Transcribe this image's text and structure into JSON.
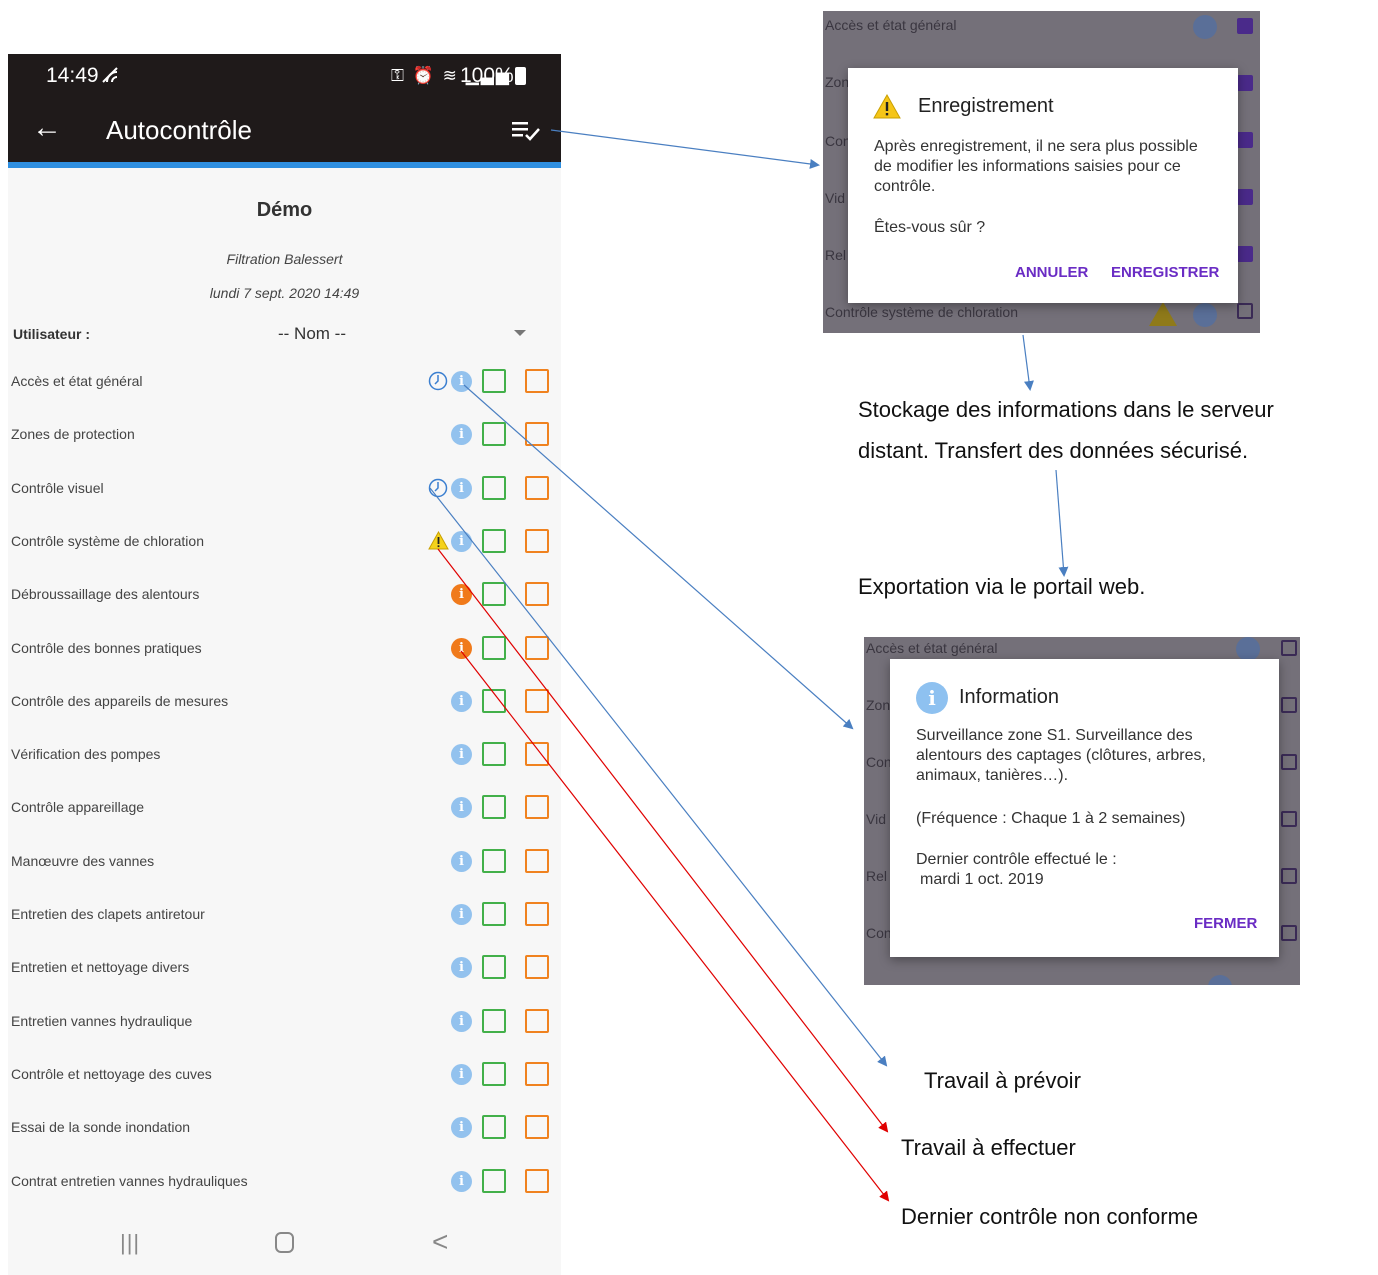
{
  "status_bar": {
    "time": "14:49",
    "signal_icon": "wifi-call-icon",
    "icons": "key alarm wifi-call signal",
    "battery": "100%"
  },
  "app_bar": {
    "title": "Autocontrôle",
    "back_icon": "arrow-left-icon",
    "action_icon": "list-check-icon"
  },
  "header": {
    "name": "Démo",
    "site": "Filtration Balessert",
    "datetime": "lundi 7 sept. 2020 14:49"
  },
  "user": {
    "label": "Utilisateur :",
    "value": "-- Nom --"
  },
  "rows": [
    {
      "label": "Accès et état général",
      "marker": "clock",
      "info": "blue"
    },
    {
      "label": "Zones de protection",
      "marker": "",
      "info": "blue"
    },
    {
      "label": "Contrôle visuel",
      "marker": "clock",
      "info": "blue"
    },
    {
      "label": "Contrôle système de chloration",
      "marker": "warning",
      "info": "blue"
    },
    {
      "label": "Débroussaillage des alentours",
      "marker": "",
      "info": "orange"
    },
    {
      "label": "Contrôle des bonnes pratiques",
      "marker": "",
      "info": "orange"
    },
    {
      "label": "Contrôle des appareils de mesures",
      "marker": "",
      "info": "blue"
    },
    {
      "label": "Vérification des pompes",
      "marker": "",
      "info": "blue"
    },
    {
      "label": "Contrôle appareillage",
      "marker": "",
      "info": "blue"
    },
    {
      "label": "Manœuvre des vannes",
      "marker": "",
      "info": "blue"
    },
    {
      "label": "Entretien des clapets antiretour",
      "marker": "",
      "info": "blue"
    },
    {
      "label": "Entretien et nettoyage divers",
      "marker": "",
      "info": "blue"
    },
    {
      "label": "Entretien vannes hydraulique",
      "marker": "",
      "info": "blue"
    },
    {
      "label": "Contrôle et nettoyage des cuves",
      "marker": "",
      "info": "blue"
    },
    {
      "label": "Essai de la sonde inondation",
      "marker": "",
      "info": "blue"
    },
    {
      "label": "Contrat entretien vannes hydrauliques",
      "marker": "",
      "info": "blue"
    }
  ],
  "nav_bar": {
    "recent": "|||",
    "back": "<"
  },
  "save_dialog": {
    "bg_rows": [
      "Accès et état général",
      "Zon",
      "Con",
      "Vid",
      "Rel",
      "Contrôle système de chloration"
    ],
    "title": "Enregistrement",
    "text": "Après enregistrement, il ne sera plus possible de modifier les informations saisies pour ce contrôle.",
    "question": "Êtes-vous sûr ?",
    "cancel": "ANNULER",
    "confirm": "ENREGISTRER"
  },
  "info_dialog": {
    "bg_rows": [
      "Accès et état général",
      "Zon",
      "Con",
      "Vid",
      "Rel",
      "Con"
    ],
    "title": "Information",
    "text": "Surveillance zone S1. Surveillance des alentours des captages (clôtures, arbres, animaux, tanières…).",
    "frequency": "(Fréquence : Chaque 1 à 2 semaines)",
    "last_label": "Dernier contrôle effectué le :",
    "last_date": "mardi 1 oct. 2019",
    "close": "FERMER"
  },
  "annotations": {
    "storage_line1": "Stockage des informations dans le serveur",
    "storage_line2": "distant. Transfert des données sécurisé.",
    "export": "Exportation via le portail web.",
    "work_planned": "Travail à prévoir",
    "work_todo": "Travail à effectuer",
    "last_nonconform": "Dernier contrôle non conforme"
  },
  "colors": {
    "appbar": "#1f1a1a",
    "accent_line": "#2f8fe0",
    "info_blue": "#93c2ee",
    "info_orange": "#f07a1b",
    "check_green": "#43b04a",
    "check_orange": "#f0821f",
    "dialog_button": "#6a2cc4",
    "arrow_blue": "#4a7fc1",
    "arrow_red": "#e00000"
  }
}
